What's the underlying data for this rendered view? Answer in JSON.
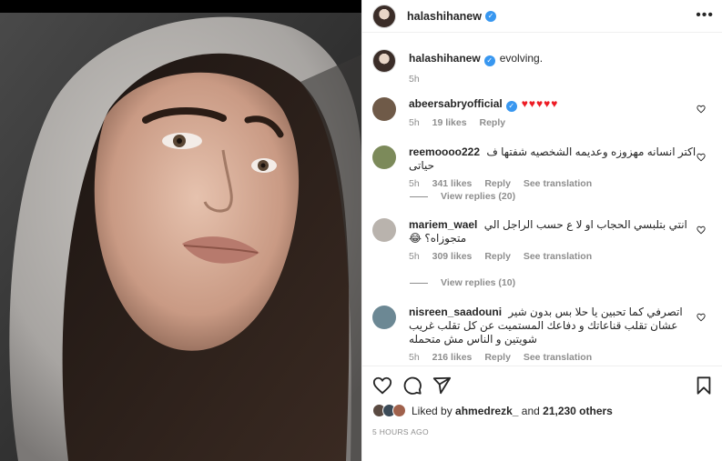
{
  "post": {
    "owner": "halashihanew",
    "caption_user": "halashihanew",
    "caption_text": "evolving.",
    "caption_time": "5h"
  },
  "comments": [
    {
      "user": "abeersabryofficial",
      "text": "♥♥♥♥♥",
      "time": "5h",
      "likes": "19 likes",
      "reply": "Reply",
      "see_translation": "",
      "verified": true,
      "avatar_color": "#6f5a48"
    },
    {
      "user": "reemoooo222",
      "text": "اكتر انسانه مهزوزه وعديمه الشخصيه شفتها ف حياتى",
      "time": "5h",
      "likes": "341 likes",
      "reply": "Reply",
      "see_translation": "See translation",
      "verified": false,
      "avatar_color": "#7c8a5a"
    },
    {
      "user": "mariem_wael",
      "text": "انتي بتلبسي الحجاب او لا ع حسب الراجل الي متجوزاه؟ 😂",
      "time": "5h",
      "likes": "309 likes",
      "reply": "Reply",
      "see_translation": "See translation",
      "verified": false,
      "avatar_color": "#b9b3ad"
    },
    {
      "user": "nisreen_saadouni",
      "text": "اتصرفي كما تحبين يا حلا بس بدون شير عشان تقلب قناعاتك و دفاعك المستميت عن كل تقلب غريب شويتين و الناس مش متحمله",
      "time": "5h",
      "likes": "216 likes",
      "reply": "Reply",
      "see_translation": "See translation",
      "verified": false,
      "avatar_color": "#6c8894"
    }
  ],
  "replies": [
    {
      "label": "View replies (20)"
    },
    {
      "label": "View replies (10)"
    }
  ],
  "likes": {
    "prefix": "Liked by",
    "user": "ahmedrezk_",
    "middle": "and",
    "count": "21,230 others"
  },
  "time_ago": "5 HOURS AGO",
  "icons": {
    "more": "more-horizontal-icon",
    "like": "heart-icon",
    "comment": "comment-icon",
    "share": "share-icon",
    "save": "bookmark-icon"
  },
  "colors": {
    "verified": "#3897f0",
    "secondary_text": "#8e8e8e",
    "heart": "#ed1b24"
  }
}
